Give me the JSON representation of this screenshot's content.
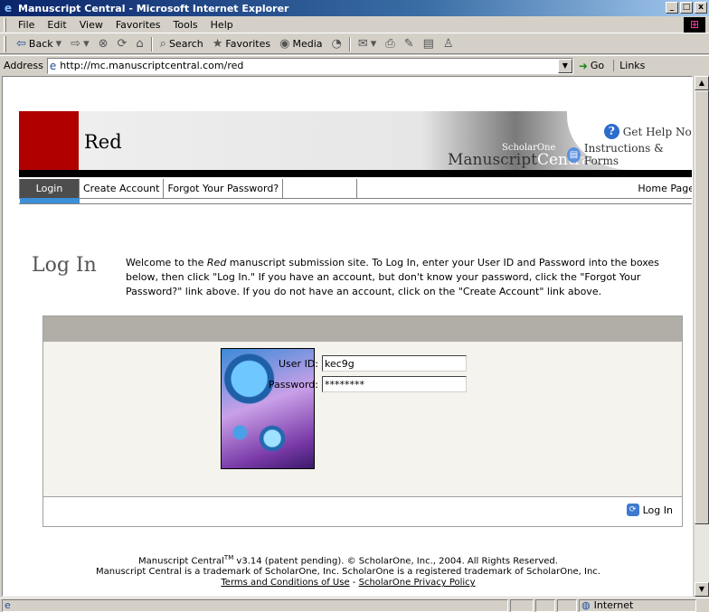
{
  "window": {
    "title": "Manuscript Central - Microsoft Internet Explorer",
    "controls": [
      "_",
      "□",
      "x"
    ]
  },
  "menu": [
    "File",
    "Edit",
    "View",
    "Favorites",
    "Tools",
    "Help"
  ],
  "toolbar": {
    "back": "Back",
    "search": "Search",
    "favorites": "Favorites",
    "media": "Media"
  },
  "address": {
    "label": "Address",
    "url": "http://mc.manuscriptcentral.com/red",
    "go": "Go",
    "links": "Links"
  },
  "banner": {
    "site_name": "Red",
    "brand_small": "ScholarOne",
    "brand_big_1": "Manuscript",
    "brand_big_2": "Central",
    "help": "Get Help Now",
    "instructions": "Instructions & Forms"
  },
  "nav": {
    "login": "Login",
    "create_account": "Create Account",
    "forgot_password": "Forgot Your Password?",
    "home": "Home Page"
  },
  "login": {
    "title": "Log In",
    "welcome_pre": "Welcome to the ",
    "welcome_site": "Red",
    "welcome_post": " manuscript submission site. To Log In, enter your User ID and Password into the boxes below, then click \"Log In.\" If you have an account, but don't know your password, click the \"Forgot Your Password?\" link above. If you do not have an account, click on the \"Create Account\" link above.",
    "user_label": "User ID:",
    "user_value": "kec9g",
    "password_label": "Password:",
    "password_value": "********",
    "button": "Log In"
  },
  "footer": {
    "line1_pre": "Manuscript Central",
    "line1_tm": "TM",
    "line1_post": " v3.14 (patent pending). © ScholarOne, Inc., 2004. All Rights Reserved.",
    "line2": "Manuscript Central is a trademark of ScholarOne, Inc. ScholarOne is a registered trademark of ScholarOne, Inc.",
    "terms": "Terms and Conditions of Use",
    "sep": " - ",
    "privacy": "ScholarOne Privacy Policy"
  },
  "status": {
    "zone": "Internet"
  }
}
